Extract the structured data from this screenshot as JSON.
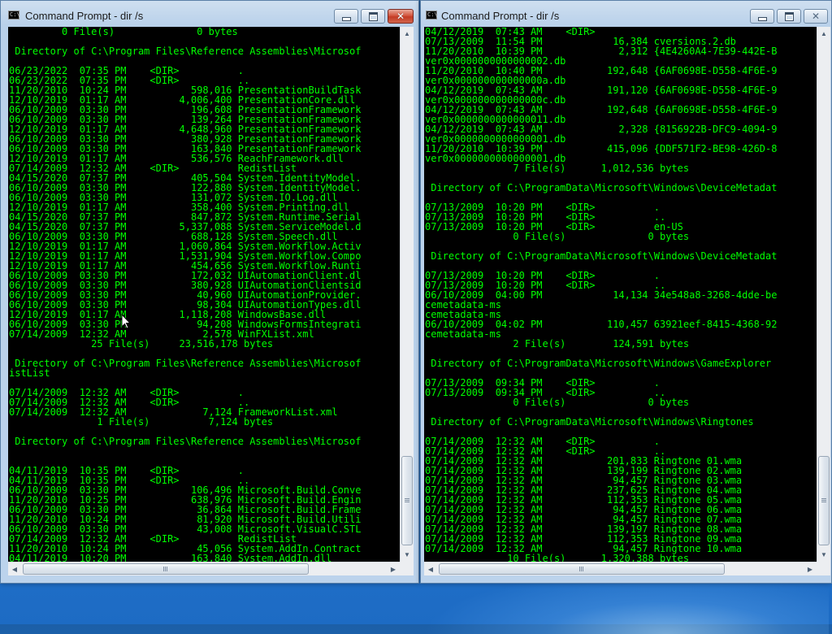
{
  "windows": {
    "left": {
      "title": "Command Prompt - dir /s",
      "icon_text": "C:\\",
      "lines": [
        "         0 File(s)              0 bytes",
        "",
        " Directory of C:\\Program Files\\Reference Assemblies\\Microsof",
        "",
        "06/23/2022  07:35 PM    <DIR>          .",
        "06/23/2022  07:35 PM    <DIR>          ..",
        "11/20/2010  10:24 PM           598,016 PresentationBuildTask",
        "12/10/2019  01:17 AM         4,006,400 PresentationCore.dll",
        "06/10/2009  03:30 PM           196,608 PresentationFramework",
        "06/10/2009  03:30 PM           139,264 PresentationFramework",
        "12/10/2019  01:17 AM         4,648,960 PresentationFramework",
        "06/10/2009  03:30 PM           380,928 PresentationFramework",
        "06/10/2009  03:30 PM           163,840 PresentationFramework",
        "12/10/2019  01:17 AM           536,576 ReachFramework.dll",
        "07/14/2009  12:32 AM    <DIR>          RedistList",
        "04/15/2020  07:37 PM           405,504 System.IdentityModel.",
        "06/10/2009  03:30 PM           122,880 System.IdentityModel.",
        "06/10/2009  03:30 PM           131,072 System.IO.Log.dll",
        "12/10/2019  01:17 AM           358,400 System.Printing.dll",
        "04/15/2020  07:37 PM           847,872 System.Runtime.Serial",
        "04/15/2020  07:37 PM         5,337,088 System.ServiceModel.d",
        "06/10/2009  03:30 PM           688,128 System.Speech.dll",
        "12/10/2019  01:17 AM         1,060,864 System.Workflow.Activ",
        "12/10/2019  01:17 AM         1,531,904 System.Workflow.Compo",
        "12/10/2019  01:17 AM           454,656 System.Workflow.Runti",
        "06/10/2009  03:30 PM           172,032 UIAutomationClient.dl",
        "06/10/2009  03:30 PM           380,928 UIAutomationClientsid",
        "06/10/2009  03:30 PM            40,960 UIAutomationProvider.",
        "06/10/2009  03:30 PM            98,304 UIAutomationTypes.dll",
        "12/10/2019  01:17 AM         1,118,208 WindowsBase.dll",
        "06/10/2009  03:30 PM            94,208 WindowsFormsIntegrati",
        "07/14/2009  12:32 AM             2,578 WinFXList.xml",
        "              25 File(s)     23,516,178 bytes",
        "",
        " Directory of C:\\Program Files\\Reference Assemblies\\Microsof",
        "istList",
        "",
        "07/14/2009  12:32 AM    <DIR>          .",
        "07/14/2009  12:32 AM    <DIR>          ..",
        "07/14/2009  12:32 AM             7,124 FrameworkList.xml",
        "               1 File(s)          7,124 bytes",
        "",
        " Directory of C:\\Program Files\\Reference Assemblies\\Microsof",
        "",
        "",
        "04/11/2019  10:35 PM    <DIR>          .",
        "04/11/2019  10:35 PM    <DIR>          ..",
        "06/10/2009  03:30 PM           106,496 Microsoft.Build.Conve",
        "11/20/2010  10:25 PM           638,976 Microsoft.Build.Engin",
        "06/10/2009  03:30 PM            36,864 Microsoft.Build.Frame",
        "11/20/2010  10:24 PM            81,920 Microsoft.Build.Utili",
        "06/10/2009  03:30 PM            43,008 Microsoft.VisualC.STL",
        "07/14/2009  12:32 AM    <DIR>          RedistList",
        "11/20/2010  10:24 PM            45,056 System.AddIn.Contract",
        "04/11/2019  10:20 PM           163,840 System.AddIn.dll"
      ]
    },
    "right": {
      "title": "Command Prompt - dir /s",
      "icon_text": "C:\\",
      "lines": [
        "04/12/2019  07:43 AM    <DIR>",
        "07/13/2009  11:54 PM            16,384 cversions.2.db",
        "11/20/2010  10:39 PM             2,312 {4E4260A4-7E39-442E-B",
        "ver0x0000000000000002.db",
        "11/20/2010  10:40 PM           192,648 {6AF0698E-D558-4F6E-9",
        "ver0x000000000000000a.db",
        "04/12/2019  07:43 AM           191,120 {6AF0698E-D558-4F6E-9",
        "ver0x000000000000000c.db",
        "04/12/2019  07:43 AM           192,648 {6AF0698E-D558-4F6E-9",
        "ver0x0000000000000011.db",
        "04/12/2019  07:43 AM             2,328 {8156922B-DFC9-4094-9",
        "ver0x0000000000000001.db",
        "11/20/2010  10:39 PM           415,096 {DDF571F2-BE98-426D-8",
        "ver0x0000000000000001.db",
        "               7 File(s)      1,012,536 bytes",
        "",
        " Directory of C:\\ProgramData\\Microsoft\\Windows\\DeviceMetadat",
        "",
        "07/13/2009  10:20 PM    <DIR>          .",
        "07/13/2009  10:20 PM    <DIR>          ..",
        "07/13/2009  10:20 PM    <DIR>          en-US",
        "               0 File(s)              0 bytes",
        "",
        " Directory of C:\\ProgramData\\Microsoft\\Windows\\DeviceMetadat",
        "",
        "07/13/2009  10:20 PM    <DIR>          .",
        "07/13/2009  10:20 PM    <DIR>          ..",
        "06/10/2009  04:00 PM            14,134 34e548a8-3268-4dde-be",
        "cemetadata-ms",
        "cemetadata-ms",
        "06/10/2009  04:02 PM           110,457 63921eef-8415-4368-92",
        "cemetadata-ms",
        "               2 File(s)        124,591 bytes",
        "",
        " Directory of C:\\ProgramData\\Microsoft\\Windows\\GameExplorer",
        "",
        "07/13/2009  09:34 PM    <DIR>          .",
        "07/13/2009  09:34 PM    <DIR>          ..",
        "               0 File(s)              0 bytes",
        "",
        " Directory of C:\\ProgramData\\Microsoft\\Windows\\Ringtones",
        "",
        "07/14/2009  12:32 AM    <DIR>          .",
        "07/14/2009  12:32 AM    <DIR>          ..",
        "07/14/2009  12:32 AM           201,833 Ringtone 01.wma",
        "07/14/2009  12:32 AM           139,199 Ringtone 02.wma",
        "07/14/2009  12:32 AM            94,457 Ringtone 03.wma",
        "07/14/2009  12:32 AM           237,625 Ringtone 04.wma",
        "07/14/2009  12:32 AM           112,353 Ringtone 05.wma",
        "07/14/2009  12:32 AM            94,457 Ringtone 06.wma",
        "07/14/2009  12:32 AM            94,457 Ringtone 07.wma",
        "07/14/2009  12:32 AM           139,197 Ringtone 08.wma",
        "07/14/2009  12:32 AM           112,353 Ringtone 09.wma",
        "07/14/2009  12:32 AM            94,457 Ringtone 10.wma",
        "              10 File(s)      1,320,388 bytes"
      ]
    }
  },
  "colors": {
    "console_text": "#00ff00",
    "console_bg": "#000000",
    "desktop": "#1f6bc0"
  }
}
